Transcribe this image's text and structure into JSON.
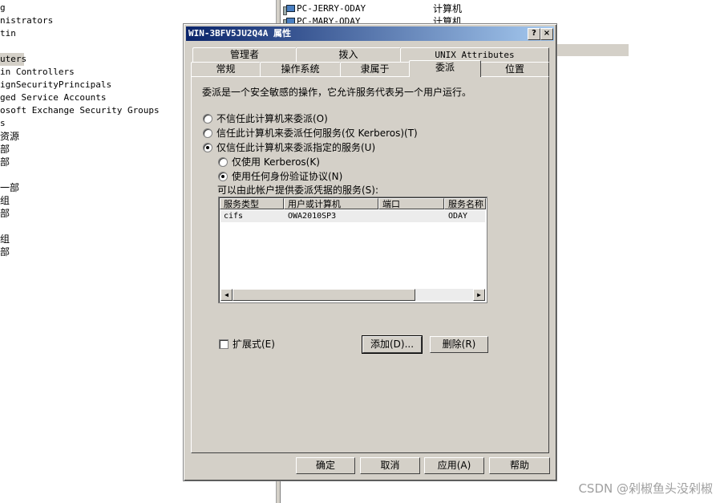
{
  "tree": {
    "items": [
      {
        "label": "g"
      },
      {
        "label": "nistrators"
      },
      {
        "label": "tin"
      },
      {
        "label": ""
      },
      {
        "label": "uters"
      },
      {
        "label": "in Controllers"
      },
      {
        "label": "ignSecurityPrincipals"
      },
      {
        "label": "ged Service Accounts"
      },
      {
        "label": "osoft Exchange Security Groups"
      },
      {
        "label": "s"
      },
      {
        "label": "资源"
      },
      {
        "label": "部"
      },
      {
        "label": "部"
      },
      {
        "label": ""
      },
      {
        "label": "一部"
      },
      {
        "label": "组"
      },
      {
        "label": "部"
      },
      {
        "label": ""
      },
      {
        "label": "组"
      },
      {
        "label": "部"
      }
    ]
  },
  "list": {
    "rows": [
      {
        "name": "PC-JERRY-ODAY",
        "type": "计算机"
      },
      {
        "name": "PC-MARY-ODAY",
        "type": "计算机"
      }
    ]
  },
  "dialog": {
    "title": "WIN-3BFV5JU2Q4A 属性",
    "help_btn": "?",
    "close_btn": "×",
    "tabs_row1": [
      "管理者",
      "拨入",
      "UNIX Attributes"
    ],
    "tabs_row2": [
      "常规",
      "操作系统",
      "隶属于",
      "委派",
      "位置"
    ],
    "description": "委派是一个安全敏感的操作，它允许服务代表另一个用户运行。",
    "radio_no_trust": "不信任此计算机来委派(O)",
    "radio_trust_any": "信任此计算机来委派任何服务(仅 Kerberos)(T)",
    "radio_trust_specified": "仅信任此计算机来委派指定的服务(U)",
    "radio_kerberos_only": "仅使用 Kerberos(K)",
    "radio_any_protocol": "使用任何身份验证协议(N)",
    "services_label": "可以由此帐户提供委派凭据的服务(S):",
    "columns": [
      "服务类型",
      "用户或计算机",
      "端口",
      "服务名称"
    ],
    "rows": [
      {
        "type": "cifs",
        "host": "OWA2010SP3",
        "port": "",
        "service": "ODAY"
      }
    ],
    "expanded_label": "扩展式(E)",
    "add_btn": "添加(D)...",
    "remove_btn": "删除(R)",
    "ok_btn": "确定",
    "cancel_btn": "取消",
    "apply_btn": "应用(A)",
    "help_bottom_btn": "帮助"
  },
  "watermark": "CSDN @剁椒鱼头没剁椒"
}
